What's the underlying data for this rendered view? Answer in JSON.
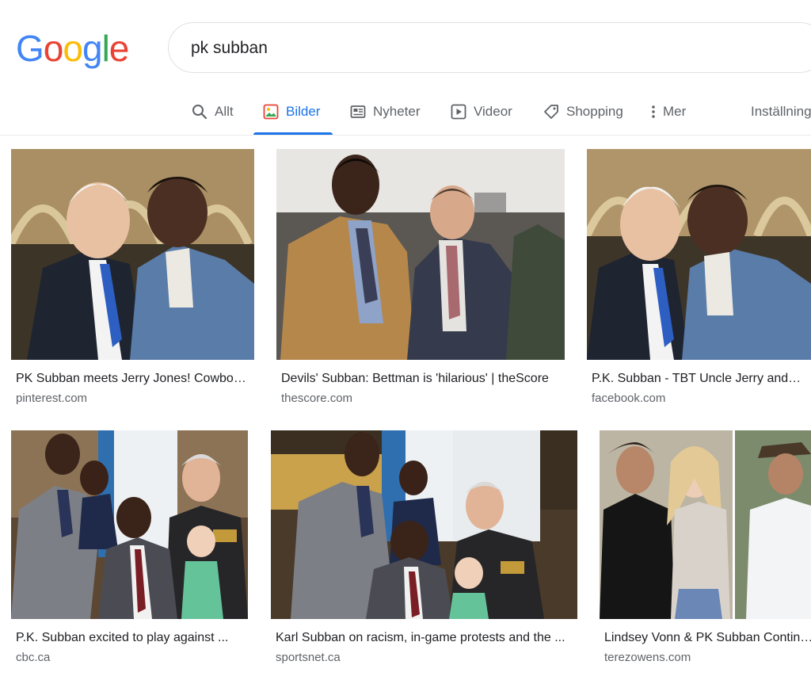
{
  "logo": {
    "letters": [
      "G",
      "o",
      "o",
      "g",
      "l",
      "e"
    ],
    "colors": [
      "#4285F4",
      "#EA4335",
      "#FBBC05",
      "#4285F4",
      "#34A853",
      "#EA4335"
    ]
  },
  "search": {
    "query": "pk subban"
  },
  "tabs": [
    {
      "label": "Allt",
      "icon": "search-icon",
      "active": false
    },
    {
      "label": "Bilder",
      "icon": "image-icon",
      "active": true
    },
    {
      "label": "Nyheter",
      "icon": "news-icon",
      "active": false
    },
    {
      "label": "Videor",
      "icon": "play-icon",
      "active": false
    },
    {
      "label": "Shopping",
      "icon": "tag-icon",
      "active": false
    },
    {
      "label": "Mer",
      "icon": "more-vert-icon",
      "active": false
    },
    {
      "label": "Inställningar",
      "icon": "",
      "active": false
    }
  ],
  "accent_color": "#1a73e8",
  "results": [
    {
      "title": "PK Subban meets Jerry Jones! Cowboys ...",
      "source": "pinterest.com"
    },
    {
      "title": "Devils' Subban: Bettman is 'hilarious' | theScore",
      "source": "thescore.com"
    },
    {
      "title": "P.K. Subban - TBT Uncle Jerry and ...",
      "source": "facebook.com"
    },
    {
      "title": "P.K. Subban excited to play against ...",
      "source": "cbc.ca"
    },
    {
      "title": "Karl Subban on racism, in-game protests and the ...",
      "source": "sportsnet.ca"
    },
    {
      "title": "Lindsey Vonn & PK Subban Continue ...",
      "source": "terezowens.com"
    }
  ]
}
